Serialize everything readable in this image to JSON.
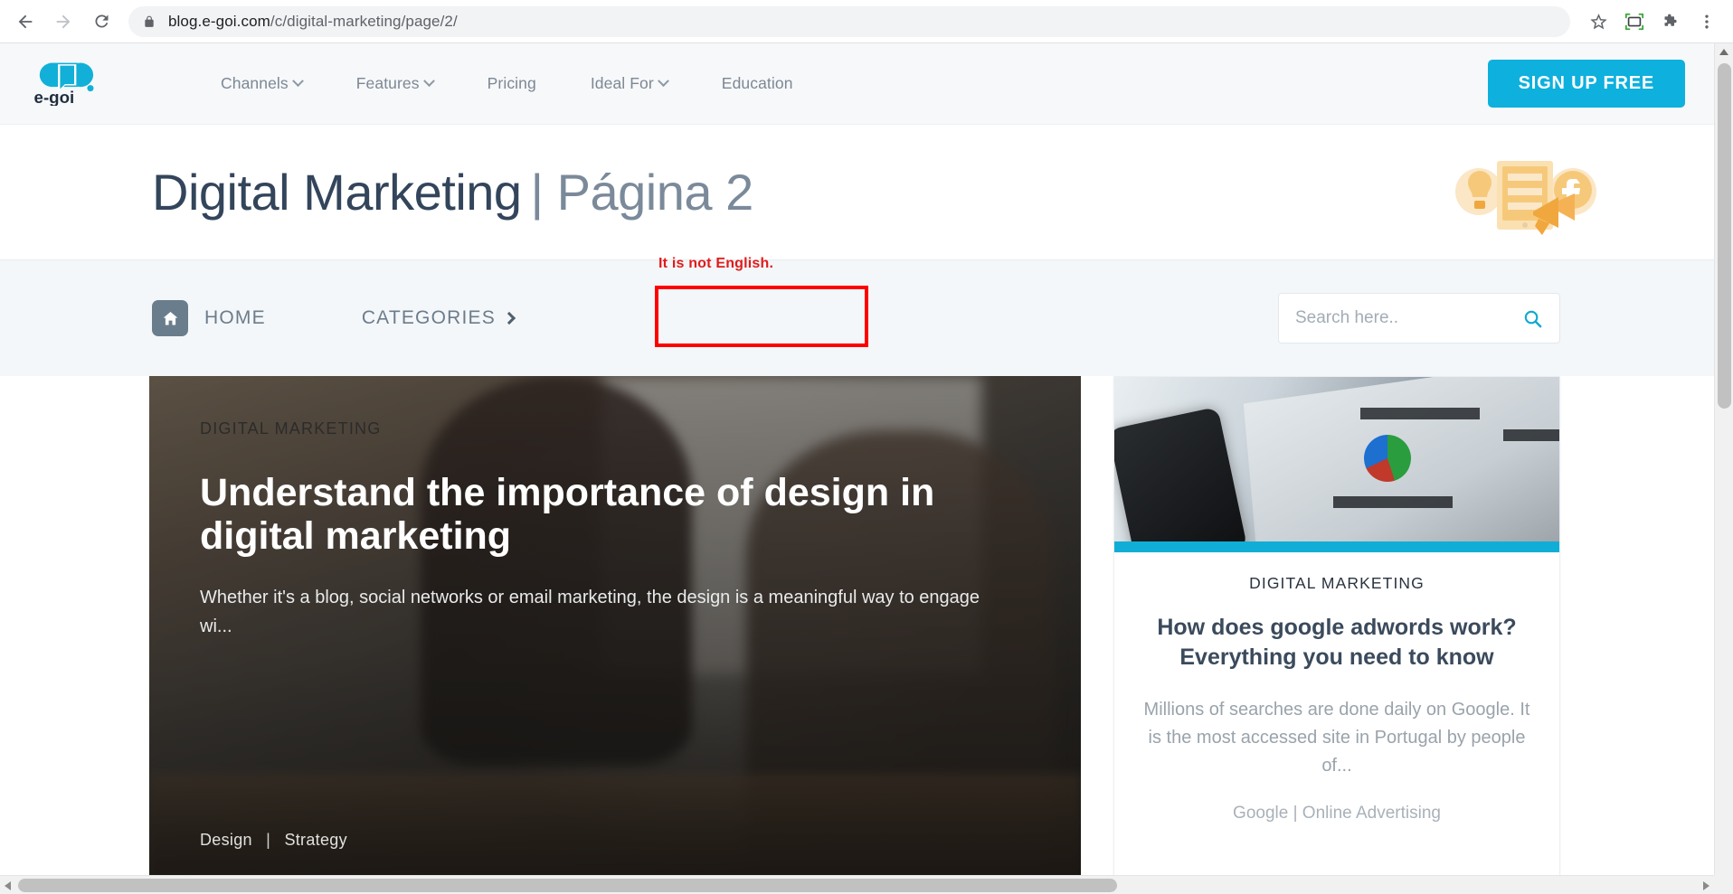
{
  "browser": {
    "back_label": "Back",
    "forward_label": "Forward",
    "reload_label": "Reload",
    "url_host": "blog.e-goi.com",
    "url_path": "/c/digital-marketing/page/2/",
    "lock_icon": "lock-icon",
    "bookmark_icon": "star-icon",
    "cast_icon": "picture-in-picture-icon",
    "extensions_icon": "puzzle-icon",
    "menu_icon": "three-dot-menu-icon"
  },
  "site_header": {
    "logo_text": "e-goi",
    "nav": [
      {
        "label": "Channels",
        "has_caret": true
      },
      {
        "label": "Features",
        "has_caret": true
      },
      {
        "label": "Pricing",
        "has_caret": false
      },
      {
        "label": "Ideal For",
        "has_caret": true
      },
      {
        "label": "Education",
        "has_caret": false
      }
    ],
    "cta_label": "SIGN UP FREE",
    "cta_color": "#0eb0dd",
    "background": "#f6f8fa"
  },
  "title_band": {
    "title": "Digital Marketing",
    "title_suffix": "| Página 2",
    "title_color": "#33455b",
    "suffix_color": "#7b8a9a",
    "illustration": "marketing-illustration"
  },
  "annotation": {
    "text": "It is not English.",
    "color": "#e01b1b",
    "box_color": "#ff0000",
    "target": "Página 2"
  },
  "breadcrumb": {
    "home_icon": "home-icon",
    "home_label": "HOME",
    "categories_label": "CATEGORIES",
    "chevron_icon": "chevron-right-icon"
  },
  "search": {
    "placeholder": "Search here..",
    "value": "",
    "icon": "search-icon",
    "icon_color": "#12a9cf"
  },
  "featured_post": {
    "category": "DIGITAL MARKETING",
    "title": "Understand the importance of design in digital marketing",
    "excerpt": "Whether it's a blog, social networks or email marketing, the design is a meaningful way to engage wi...",
    "tag_1": "Design",
    "tag_separator": "|",
    "tag_2": "Strategy"
  },
  "side_post": {
    "category": "DIGITAL MARKETING",
    "title": "How does google adwords work? Everything you need to know",
    "excerpt": "Millions of searches are done daily on Google. It is the most accessed site in Portugal by people of...",
    "tags": "Google | Online Advertising",
    "accent_bar_color": "#10aed6"
  },
  "scrollbars": {
    "vertical_up_icon": "scroll-up-arrow-icon",
    "horizontal_left_icon": "scroll-left-arrow-icon",
    "horizontal_right_icon": "scroll-right-arrow-icon"
  }
}
